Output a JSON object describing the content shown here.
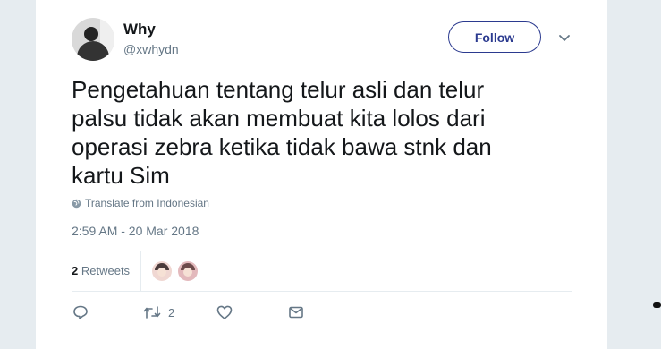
{
  "user": {
    "name": "Why",
    "handle": "@xwhydn"
  },
  "follow_button": {
    "label": "Follow"
  },
  "tweet": {
    "lines": [
      "Pengetahuan tentang telur asli dan telur",
      "palsu tidak akan membuat kita lolos dari",
      "operasi zebra ketika tidak bawa stnk dan",
      "kartu Sim"
    ],
    "translate_label": "Translate from Indonesian",
    "timestamp": "2:59 AM - 20 Mar 2018"
  },
  "stats": {
    "retweets_count": "2",
    "retweets_label": "Retweets"
  },
  "actions": {
    "retweet_count": "2"
  },
  "colors": {
    "accent": "#2b3a8f",
    "text": "#14171a",
    "secondary": "#657786",
    "background": "#e6ecf0"
  },
  "icons": [
    "chevron-down-icon",
    "globe-icon",
    "reply-icon",
    "retweet-icon",
    "like-icon",
    "message-icon"
  ]
}
